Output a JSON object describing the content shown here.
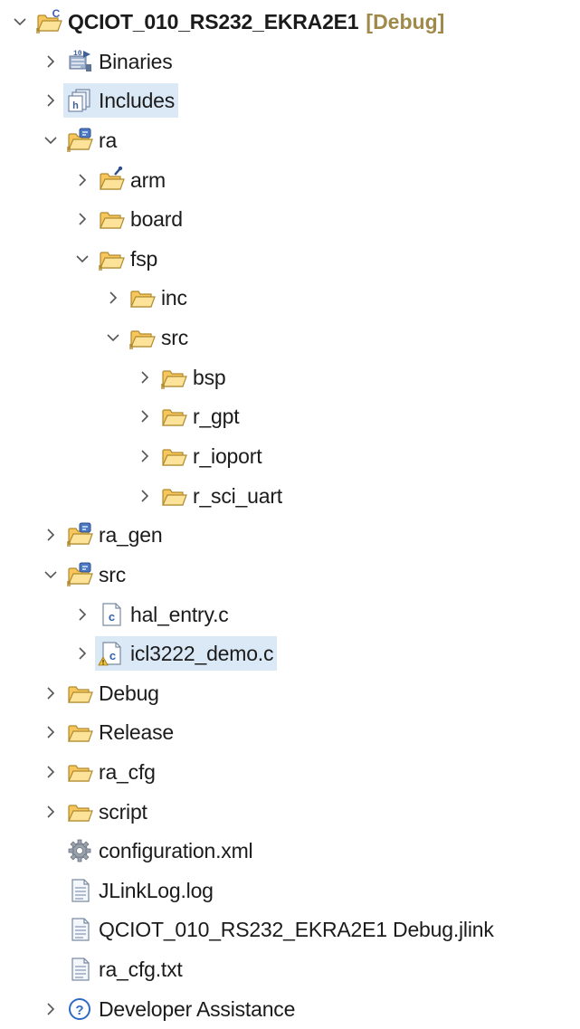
{
  "project": {
    "name": "QCIOT_010_RS232_EKRA2E1",
    "config": "[Debug]"
  },
  "items": {
    "binaries": "Binaries",
    "includes": "Includes",
    "ra": "ra",
    "arm": "arm",
    "board": "board",
    "fsp": "fsp",
    "inc": "inc",
    "fsp_src": "src",
    "bsp": "bsp",
    "r_gpt": "r_gpt",
    "r_ioport": "r_ioport",
    "r_sci_uart": "r_sci_uart",
    "ra_gen": "ra_gen",
    "src": "src",
    "hal_entry": "hal_entry.c",
    "icl3222_demo": "icl3222_demo.c",
    "debug": "Debug",
    "release": "Release",
    "ra_cfg": "ra_cfg",
    "script": "script",
    "configuration_xml": "configuration.xml",
    "jlinklog": "JLinkLog.log",
    "jlink_file": "QCIOT_010_RS232_EKRA2E1 Debug.jlink",
    "ra_cfg_txt": "ra_cfg.txt",
    "developer_assistance": "Developer Assistance"
  },
  "colors": {
    "selection": "#dbe9f7",
    "folder_fill": "#f7c65c",
    "folder_stroke": "#b08a2e",
    "source_folder_badge": "#4a78c2",
    "decorator_text": "#a08a4a"
  },
  "icons": {
    "project": "c-project-folder-icon",
    "binaries": "binaries-icon",
    "includes": "includes-icon",
    "source_folder": "source-folder-icon",
    "folder": "folder-icon",
    "c_file": "c-source-file-icon",
    "gear": "gear-file-icon",
    "text_file": "text-file-icon",
    "help": "help-circle-icon"
  }
}
